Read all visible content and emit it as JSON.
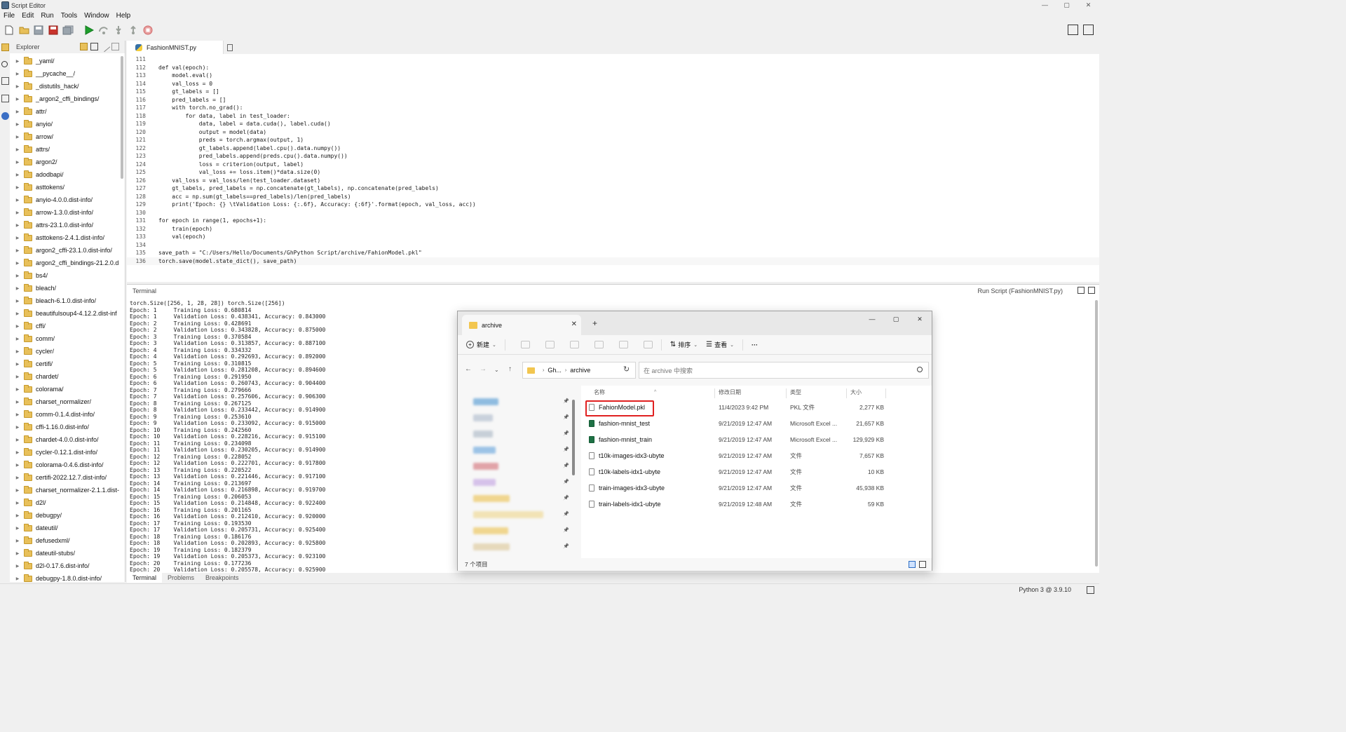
{
  "window": {
    "title": "Script Editor",
    "min": "—",
    "max": "▢",
    "close": "✕"
  },
  "menu": [
    "File",
    "Edit",
    "Run",
    "Tools",
    "Window",
    "Help"
  ],
  "toolbar": {
    "icons": [
      "new-file-icon",
      "open-folder-icon",
      "save-icon",
      "save-as-icon",
      "save-all-icon",
      "run-icon",
      "step-over-icon",
      "step-into-icon",
      "step-out-icon",
      "stop-icon"
    ]
  },
  "explorer": {
    "title": "Explorer",
    "items": [
      "_yaml/",
      "__pycache__/",
      "_distutils_hack/",
      "_argon2_cffi_bindings/",
      "attr/",
      "anyio/",
      "arrow/",
      "attrs/",
      "argon2/",
      "adodbapi/",
      "asttokens/",
      "anyio-4.0.0.dist-info/",
      "arrow-1.3.0.dist-info/",
      "attrs-23.1.0.dist-info/",
      "asttokens-2.4.1.dist-info/",
      "argon2_cffi-23.1.0.dist-info/",
      "argon2_cffi_bindings-21.2.0.d",
      "bs4/",
      "bleach/",
      "bleach-6.1.0.dist-info/",
      "beautifulsoup4-4.12.2.dist-inf",
      "cffi/",
      "comm/",
      "cycler/",
      "certifi/",
      "chardet/",
      "colorama/",
      "charset_normalizer/",
      "comm-0.1.4.dist-info/",
      "cffi-1.16.0.dist-info/",
      "chardet-4.0.0.dist-info/",
      "cycler-0.12.1.dist-info/",
      "colorama-0.4.6.dist-info/",
      "certifi-2022.12.7.dist-info/",
      "charset_normalizer-2.1.1.dist-",
      "d2l/",
      "debugpy/",
      "dateutil/",
      "defusedxml/",
      "dateutil-stubs/",
      "d2l-0.17.6.dist-info/",
      "debugpy-1.8.0.dist-info/"
    ]
  },
  "editor": {
    "tab": "FashionMNIST.py",
    "current_line": "136",
    "lines": [
      {
        "n": "111",
        "t": ""
      },
      {
        "n": "112",
        "t": "def val(epoch):"
      },
      {
        "n": "113",
        "t": "    model.eval()"
      },
      {
        "n": "114",
        "t": "    val_loss = 0"
      },
      {
        "n": "115",
        "t": "    gt_labels = []"
      },
      {
        "n": "116",
        "t": "    pred_labels = []"
      },
      {
        "n": "117",
        "t": "    with torch.no_grad():"
      },
      {
        "n": "118",
        "t": "        for data, label in test_loader:"
      },
      {
        "n": "119",
        "t": "            data, label = data.cuda(), label.cuda()"
      },
      {
        "n": "120",
        "t": "            output = model(data)"
      },
      {
        "n": "121",
        "t": "            preds = torch.argmax(output, 1)"
      },
      {
        "n": "122",
        "t": "            gt_labels.append(label.cpu().data.numpy())"
      },
      {
        "n": "123",
        "t": "            pred_labels.append(preds.cpu().data.numpy())"
      },
      {
        "n": "124",
        "t": "            loss = criterion(output, label)"
      },
      {
        "n": "125",
        "t": "            val_loss += loss.item()*data.size(0)"
      },
      {
        "n": "126",
        "t": "    val_loss = val_loss/len(test_loader.dataset)"
      },
      {
        "n": "127",
        "t": "    gt_labels, pred_labels = np.concatenate(gt_labels), np.concatenate(pred_labels)"
      },
      {
        "n": "128",
        "t": "    acc = np.sum(gt_labels==pred_labels)/len(pred_labels)"
      },
      {
        "n": "129",
        "t": "    print('Epoch: {} \\tValidation Loss: {:.6f}, Accuracy: {:6f}'.format(epoch, val_loss, acc))"
      },
      {
        "n": "130",
        "t": ""
      },
      {
        "n": "131",
        "t": "for epoch in range(1, epochs+1):"
      },
      {
        "n": "132",
        "t": "    train(epoch)"
      },
      {
        "n": "133",
        "t": "    val(epoch)"
      },
      {
        "n": "134",
        "t": ""
      },
      {
        "n": "135",
        "t": "save_path = \"C:/Users/Hello/Documents/GhPython Script/archive/FahionModel.pkl\""
      },
      {
        "n": "136",
        "t": "torch.save(model.state_dict(), save_path)"
      }
    ]
  },
  "terminal": {
    "title": "Terminal",
    "run_label": "Run Script (FashionMNIST.py)",
    "lines": [
      "torch.Size([256, 1, 28, 28]) torch.Size([256])",
      "Epoch: 1     Training Loss: 0.680814",
      "Epoch: 1     Validation Loss: 0.438341, Accuracy: 0.843000",
      "Epoch: 2     Training Loss: 0.428691",
      "Epoch: 2     Validation Loss: 0.343828, Accuracy: 0.875000",
      "Epoch: 3     Training Loss: 0.370584",
      "Epoch: 3     Validation Loss: 0.313857, Accuracy: 0.887100",
      "Epoch: 4     Training Loss: 0.334332",
      "Epoch: 4     Validation Loss: 0.292693, Accuracy: 0.892000",
      "Epoch: 5     Training Loss: 0.310815",
      "Epoch: 5     Validation Loss: 0.281208, Accuracy: 0.894600",
      "Epoch: 6     Training Loss: 0.291950",
      "Epoch: 6     Validation Loss: 0.260743, Accuracy: 0.904400",
      "Epoch: 7     Training Loss: 0.279666",
      "Epoch: 7     Validation Loss: 0.257606, Accuracy: 0.906300",
      "Epoch: 8     Training Loss: 0.267125",
      "Epoch: 8     Validation Loss: 0.233442, Accuracy: 0.914900",
      "Epoch: 9     Training Loss: 0.253610",
      "Epoch: 9     Validation Loss: 0.233092, Accuracy: 0.915000",
      "Epoch: 10    Training Loss: 0.242560",
      "Epoch: 10    Validation Loss: 0.228216, Accuracy: 0.915100",
      "Epoch: 11    Training Loss: 0.234098",
      "Epoch: 11    Validation Loss: 0.230205, Accuracy: 0.914900",
      "Epoch: 12    Training Loss: 0.228052",
      "Epoch: 12    Validation Loss: 0.222701, Accuracy: 0.917800",
      "Epoch: 13    Training Loss: 0.220522",
      "Epoch: 13    Validation Loss: 0.221446, Accuracy: 0.917100",
      "Epoch: 14    Training Loss: 0.213697",
      "Epoch: 14    Validation Loss: 0.216898, Accuracy: 0.919700",
      "Epoch: 15    Training Loss: 0.206053",
      "Epoch: 15    Validation Loss: 0.214848, Accuracy: 0.922400",
      "Epoch: 16    Training Loss: 0.201165",
      "Epoch: 16    Validation Loss: 0.212410, Accuracy: 0.920000",
      "Epoch: 17    Training Loss: 0.193530",
      "Epoch: 17    Validation Loss: 0.205731, Accuracy: 0.925400",
      "Epoch: 18    Training Loss: 0.186176",
      "Epoch: 18    Validation Loss: 0.202893, Accuracy: 0.925800",
      "Epoch: 19    Training Loss: 0.182379",
      "Epoch: 19    Validation Loss: 0.205373, Accuracy: 0.923100",
      "Epoch: 20    Training Loss: 0.177236",
      "Epoch: 20    Validation Loss: 0.205578, Accuracy: 0.925900"
    ]
  },
  "bottom_tabs": [
    "Terminal",
    "Problems",
    "Breakpoints"
  ],
  "status": {
    "python": "Python 3 @ 3.9.10"
  },
  "file_explorer": {
    "tab_title": "archive",
    "tab_close": "✕",
    "new_tab": "+",
    "win_min": "—",
    "win_max": "▢",
    "win_close": "✕",
    "cmd_new": "新建",
    "cmd_sort": "排序",
    "cmd_view": "查看",
    "cmd_more": "···",
    "breadcrumb": [
      "Gh...",
      "archive"
    ],
    "search_placeholder": "在 archive 中搜索",
    "columns": [
      "名称",
      "修改日期",
      "类型",
      "大小"
    ],
    "files": [
      {
        "name": "FahionModel.pkl",
        "date": "11/4/2023 9:42 PM",
        "type": "PKL 文件",
        "size": "2,277 KB",
        "icon": "file-icon"
      },
      {
        "name": "fashion-mnist_test",
        "date": "9/21/2019 12:47 AM",
        "type": "Microsoft Excel ...",
        "size": "21,657 KB",
        "icon": "excel-icon"
      },
      {
        "name": "fashion-mnist_train",
        "date": "9/21/2019 12:47 AM",
        "type": "Microsoft Excel ...",
        "size": "129,929 KB",
        "icon": "excel-icon"
      },
      {
        "name": "t10k-images-idx3-ubyte",
        "date": "9/21/2019 12:47 AM",
        "type": "文件",
        "size": "7,657 KB",
        "icon": "file-icon"
      },
      {
        "name": "t10k-labels-idx1-ubyte",
        "date": "9/21/2019 12:47 AM",
        "type": "文件",
        "size": "10 KB",
        "icon": "file-icon"
      },
      {
        "name": "train-images-idx3-ubyte",
        "date": "9/21/2019 12:47 AM",
        "type": "文件",
        "size": "45,938 KB",
        "icon": "file-icon"
      },
      {
        "name": "train-labels-idx1-ubyte",
        "date": "9/21/2019 12:48 AM",
        "type": "文件",
        "size": "59 KB",
        "icon": "file-icon"
      }
    ],
    "item_count": "7 个项目",
    "highlight_color": "#e02020"
  }
}
